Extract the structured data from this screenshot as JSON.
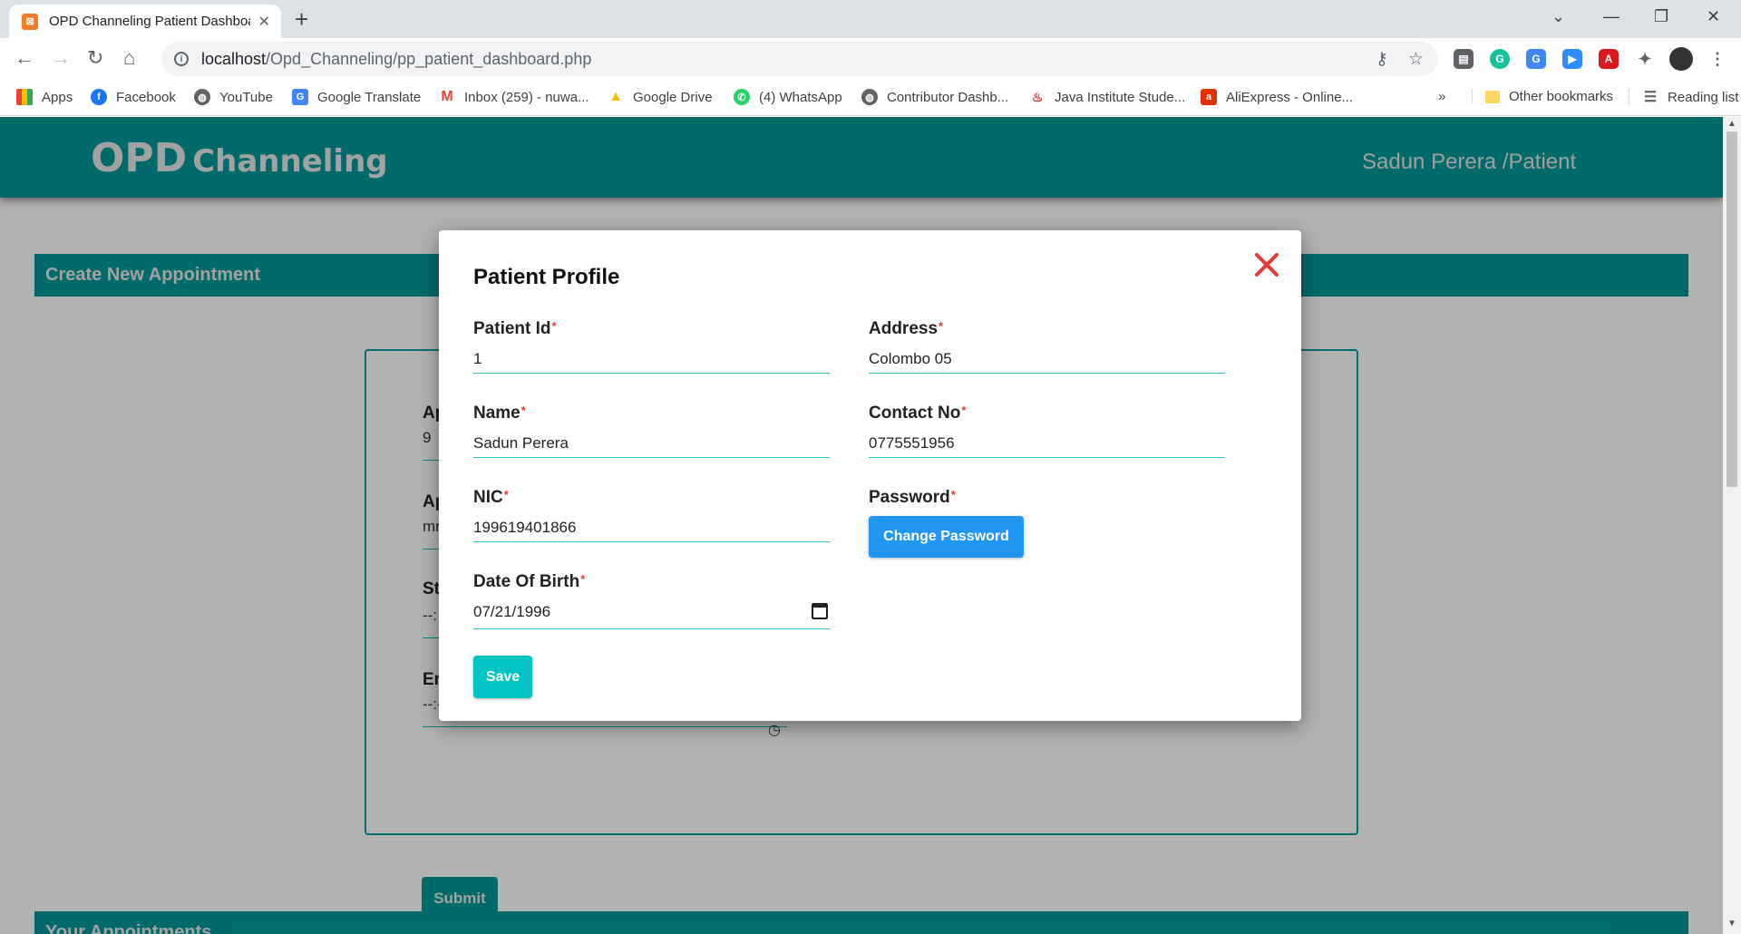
{
  "browser": {
    "tab_title": "OPD Channeling Patient Dashboard",
    "url_host": "localhost",
    "url_path": "/Opd_Channeling/pp_patient_dashboard.php",
    "bookmarks": [
      "Apps",
      "Facebook",
      "YouTube",
      "Google Translate",
      "Inbox (259) - nuwa...",
      "Google Drive",
      "(4) WhatsApp",
      "Contributor Dashb...",
      "Java Institute Stude...",
      "AliExpress - Online..."
    ],
    "overflow": "»",
    "other_bookmarks": "Other bookmarks",
    "reading_list": "Reading list"
  },
  "header": {
    "brand_part1": "OPD",
    "brand_part2": "Channeling",
    "user": "Sadun Perera /Patient"
  },
  "background": {
    "create_title": "Create New Appointment",
    "fields": [
      {
        "label": "Ap",
        "value": "9"
      },
      {
        "label": "Ap",
        "value": "mr"
      },
      {
        "label": "St",
        "value": "--:"
      },
      {
        "label": "Er",
        "value": "--:-- --"
      }
    ],
    "submit_label": "Submit",
    "appointments_title": "Your Appointments"
  },
  "modal": {
    "title": "Patient Profile",
    "patient_id": {
      "label": "Patient Id",
      "value": "1"
    },
    "name": {
      "label": "Name",
      "value": "Sadun Perera"
    },
    "nic": {
      "label": "NIC",
      "value": "199619401866"
    },
    "dob": {
      "label": "Date Of Birth",
      "value": "07/21/1996"
    },
    "address": {
      "label": "Address",
      "value": "Colombo 05"
    },
    "contact": {
      "label": "Contact No",
      "value": "0775551956"
    },
    "password": {
      "label": "Password"
    },
    "change_password_label": "Change Password",
    "save_label": "Save",
    "required_mark": "*"
  },
  "colors": {
    "header_teal": "#009999",
    "close_red": "#e53935",
    "primary_blue": "#2196f3",
    "save_cyan": "#00c4c4"
  }
}
